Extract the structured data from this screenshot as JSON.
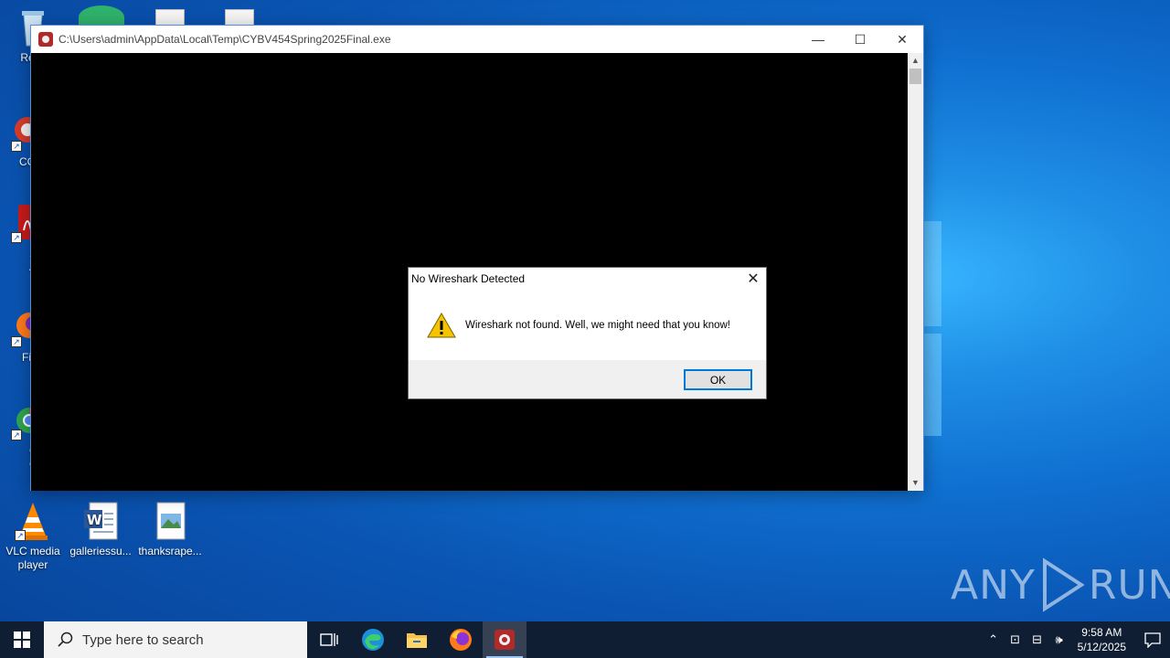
{
  "desktop": {
    "icons": [
      {
        "label": "Recy",
        "name": "recycle-bin"
      },
      {
        "label": "CCl",
        "name": "ccleaner"
      },
      {
        "label": "Ad Acr",
        "name": "adobe-acrobat"
      },
      {
        "label": "Fir",
        "name": "firefox"
      },
      {
        "label": "Goo Chr",
        "name": "google-chrome"
      },
      {
        "label": "VLC media player",
        "name": "vlc-media-player"
      },
      {
        "label": "galleriessu...",
        "name": "galleriessu-doc"
      },
      {
        "label": "thanksrape...",
        "name": "thanksrape-image"
      }
    ]
  },
  "window": {
    "title": "C:\\Users\\admin\\AppData\\Local\\Temp\\CYBV454Spring2025Final.exe",
    "minimize": "—",
    "maximize": "☐",
    "close": "✕"
  },
  "dialog": {
    "title": "No Wireshark Detected",
    "message": "Wireshark not found. Well, we might need that you know!",
    "ok_label": "OK",
    "close": "✕"
  },
  "watermark": {
    "left": "ANY",
    "right": "RUN"
  },
  "taskbar": {
    "search_placeholder": "Type here to search",
    "time": "9:58 AM",
    "date": "5/12/2025"
  },
  "colors": {
    "accent": "#0078d7",
    "taskbar": "#101e33",
    "console": "#000000"
  }
}
